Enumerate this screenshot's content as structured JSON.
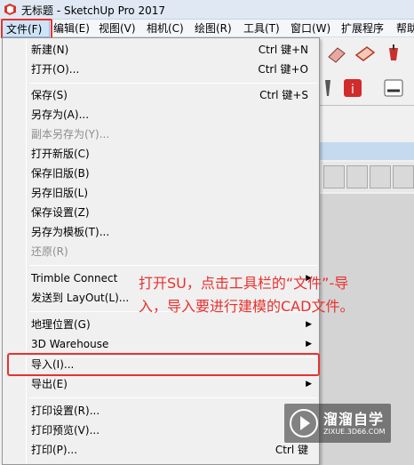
{
  "window": {
    "title": "无标题 - SketchUp Pro 2017"
  },
  "menubar": {
    "items": [
      "文件(F)",
      "编辑(E)",
      "视图(V)",
      "相机(C)",
      "绘图(R)",
      "工具(T)",
      "窗口(W)",
      "扩展程序",
      "帮助"
    ]
  },
  "file_menu": {
    "items": [
      {
        "label": "新建(N)",
        "shortcut": "Ctrl 键+N"
      },
      {
        "label": "打开(O)...",
        "shortcut": "Ctrl 键+O"
      },
      {
        "label": "保存(S)",
        "shortcut": "Ctrl 键+S"
      },
      {
        "label": "另存为(A)..."
      },
      {
        "label": "副本另存为(Y)...",
        "disabled": true
      },
      {
        "label": "打开新版(C)"
      },
      {
        "label": "保存旧版(B)"
      },
      {
        "label": "另存旧版(L)"
      },
      {
        "label": "保存设置(Z)"
      },
      {
        "label": "另存为模板(T)..."
      },
      {
        "label": "还原(R)",
        "disabled": true
      },
      {
        "label": "Trimble Connect"
      },
      {
        "label": "发送到 LayOut(L)..."
      },
      {
        "label": "地理位置(G)"
      },
      {
        "label": "3D Warehouse"
      },
      {
        "label": "导入(I)..."
      },
      {
        "label": "导出(E)"
      },
      {
        "label": "打印设置(R)..."
      },
      {
        "label": "打印预览(V)..."
      },
      {
        "label": "打印(P)...",
        "shortcut": "Ctrl 键"
      }
    ]
  },
  "annotation": {
    "line1": "打开SU，点击工具栏的“文件”-导",
    "line2": "入，导入要进行建模的CAD文件。"
  },
  "watermark": {
    "name": "溜溜自学",
    "url": "ZIXUE.3D66.COM"
  },
  "colors": {
    "highlight": "#e8312f",
    "menu_bg": "#f0f0f0",
    "titlebar": "#dfe8f3"
  }
}
